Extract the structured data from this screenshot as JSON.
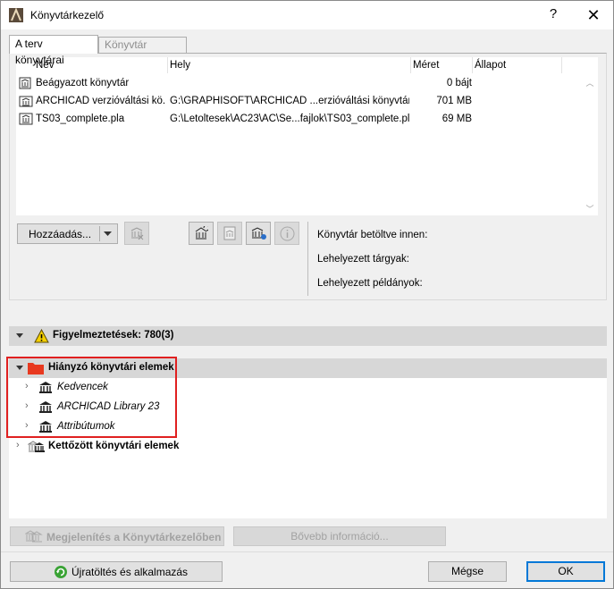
{
  "window": {
    "title": "Könyvtárkezelő",
    "help_label": "?",
    "close_label": "✕"
  },
  "tabs": [
    {
      "label": "A terv könyvtárai",
      "active": true
    },
    {
      "label": "Könyvtár tartalma",
      "active": false
    }
  ],
  "library_list": {
    "columns": [
      "Név",
      "Hely",
      "Méret",
      "Állapot"
    ],
    "rows": [
      {
        "name": "Beágyazott könyvtár",
        "location": "",
        "size": "0 bájt",
        "status": "",
        "icon": "embedded-library-icon"
      },
      {
        "name": "ARCHICAD verzióváltási kö...",
        "location": "G:\\GRAPHISOFT\\ARCHICAD ...erzióváltási könyvtárak",
        "size": "701 MB",
        "status": "",
        "icon": "folder-library-icon"
      },
      {
        "name": "TS03_complete.pla",
        "location": "G:\\Letoltesek\\AC23\\AC\\Se...fajlok\\TS03_complete.pla",
        "size": "69 MB",
        "status": "",
        "icon": "pla-file-icon"
      }
    ]
  },
  "toolbar": {
    "add_label": "Hozzáadás...",
    "add_dropdown_icon": "chevron-down-icon"
  },
  "info_panel": {
    "loaded_from": "Könyvtár betöltve innen:",
    "placed_objects": "Lehelyezett tárgyak:",
    "placed_instances": "Lehelyezett példányok:"
  },
  "warnings": {
    "label": "Figyelmeztetések: 780(3)"
  },
  "missing": {
    "label": "Hiányzó könyvtári elemek",
    "children": [
      "Kedvencek",
      "ARCHICAD Library 23",
      "Attribútumok"
    ]
  },
  "duplicate": {
    "label": "Kettőzött könyvtári elemek"
  },
  "actions": {
    "show_in_manager": "Megjelenítés a Könyvtárkezelőben",
    "more_info": "Bővebb információ..."
  },
  "footer": {
    "reload_label": "Újratöltés és alkalmazás",
    "cancel_label": "Mégse",
    "ok_label": "OK"
  },
  "colors": {
    "missing_folder": "#e8391f",
    "warning_yellow": "#f5d000",
    "reload_green": "#3aa335",
    "ok_border": "#0078d7",
    "highlight_red": "#e02020"
  }
}
